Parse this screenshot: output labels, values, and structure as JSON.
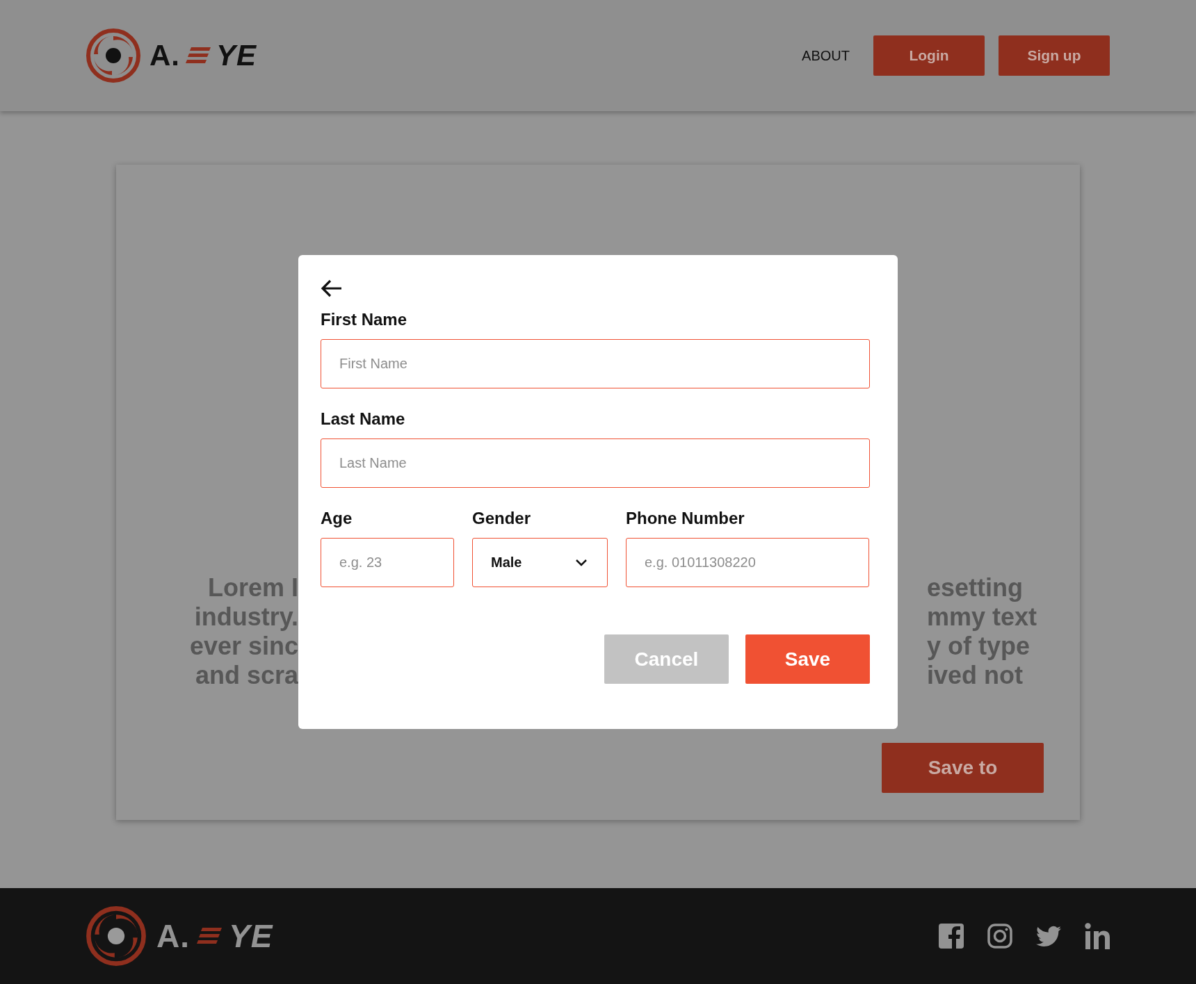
{
  "header": {
    "logo": {
      "prefix": "A.",
      "suffix": "YE"
    },
    "nav": [
      {
        "label": "ABOUT",
        "kind": "link"
      },
      {
        "label": "Login",
        "kind": "button"
      },
      {
        "label": "Sign up",
        "kind": "button"
      }
    ]
  },
  "card": {
    "text_left": [
      "Lorem I",
      "industry.",
      "ever sinc",
      "and scra"
    ],
    "text_right": [
      "esetting",
      "mmy text",
      "y of type",
      "ived not"
    ],
    "button": "Save to"
  },
  "dialog": {
    "rows": [
      [
        {
          "kind": "text",
          "label": "First Name",
          "placeholder": "First Name"
        }
      ],
      [
        {
          "kind": "text",
          "label": "Last Name",
          "placeholder": "Last Name"
        }
      ],
      [
        {
          "kind": "text",
          "label": "Age",
          "placeholder": "e.g. 23"
        },
        {
          "kind": "select",
          "label": "Gender",
          "value": "Male"
        },
        {
          "kind": "text",
          "label": "Phone Number",
          "placeholder": "e.g. 01011308220"
        }
      ]
    ],
    "buttons": [
      {
        "label": "Cancel",
        "kind": "secondary"
      },
      {
        "label": "Save",
        "kind": "primary"
      }
    ]
  },
  "footer": {
    "logo": {
      "prefix": "A.",
      "suffix": "YE"
    }
  }
}
